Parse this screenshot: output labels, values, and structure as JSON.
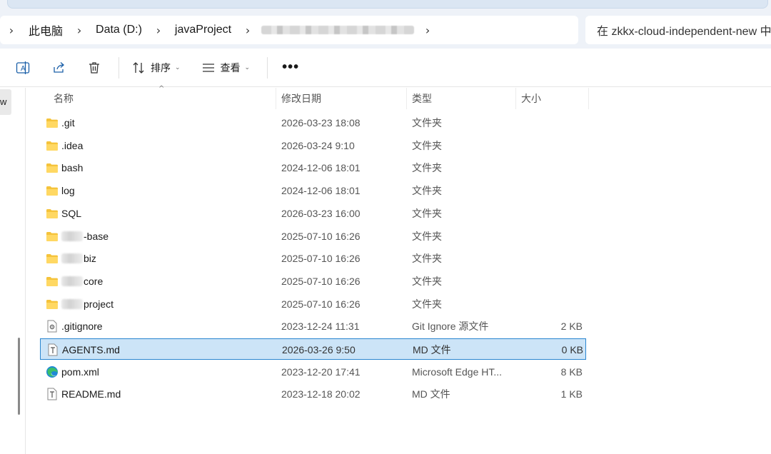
{
  "breadcrumb": {
    "items": [
      "此电脑",
      "Data (D:)",
      "javaProject"
    ]
  },
  "search": {
    "placeholder": "在 zkkx-cloud-independent-new 中"
  },
  "toolbar": {
    "sort_label": "排序",
    "view_label": "查看",
    "more_label": "•••"
  },
  "nav": {
    "stub_text": "w"
  },
  "columns": {
    "name": "名称",
    "date": "修改日期",
    "type": "类型",
    "size": "大小"
  },
  "files": [
    {
      "name": ".git",
      "date": "2026-03-23 18:08",
      "type": "文件夹",
      "size": "",
      "icon": "folder-icon"
    },
    {
      "name": ".idea",
      "date": "2026-03-24 9:10",
      "type": "文件夹",
      "size": "",
      "icon": "folder-icon"
    },
    {
      "name": "bash",
      "date": "2024-12-06 18:01",
      "type": "文件夹",
      "size": "",
      "icon": "folder-icon"
    },
    {
      "name": "log",
      "date": "2024-12-06 18:01",
      "type": "文件夹",
      "size": "",
      "icon": "folder-icon"
    },
    {
      "name": "SQL",
      "date": "2026-03-23 16:00",
      "type": "文件夹",
      "size": "",
      "icon": "folder-icon"
    },
    {
      "name": "-base",
      "date": "2025-07-10 16:26",
      "type": "文件夹",
      "size": "",
      "icon": "folder-icon",
      "blurred_prefix": true
    },
    {
      "name": "biz",
      "date": "2025-07-10 16:26",
      "type": "文件夹",
      "size": "",
      "icon": "folder-icon",
      "blurred_prefix": true
    },
    {
      "name": "core",
      "date": "2025-07-10 16:26",
      "type": "文件夹",
      "size": "",
      "icon": "folder-icon",
      "blurred_prefix": true
    },
    {
      "name": "project",
      "date": "2025-07-10 16:26",
      "type": "文件夹",
      "size": "",
      "icon": "folder-icon",
      "blurred_prefix": true
    },
    {
      "name": ".gitignore",
      "date": "2023-12-24 11:31",
      "type": "Git Ignore 源文件",
      "size": "2 KB",
      "icon": "gear-file-icon"
    },
    {
      "name": "AGENTS.md",
      "date": "2026-03-26 9:50",
      "type": "MD 文件",
      "size": "0 KB",
      "icon": "text-file-icon",
      "selected": true
    },
    {
      "name": "pom.xml",
      "date": "2023-12-20 17:41",
      "type": "Microsoft Edge HT...",
      "size": "8 KB",
      "icon": "edge-icon"
    },
    {
      "name": "README.md",
      "date": "2023-12-18 20:02",
      "type": "MD 文件",
      "size": "1 KB",
      "icon": "text-file-icon"
    }
  ],
  "colors": {
    "selection_bg": "#cce4f7",
    "selection_border": "#2a86d0",
    "folder": "#f5c33b",
    "edge_blue": "#1e88d6",
    "edge_green": "#3bbf6a"
  }
}
